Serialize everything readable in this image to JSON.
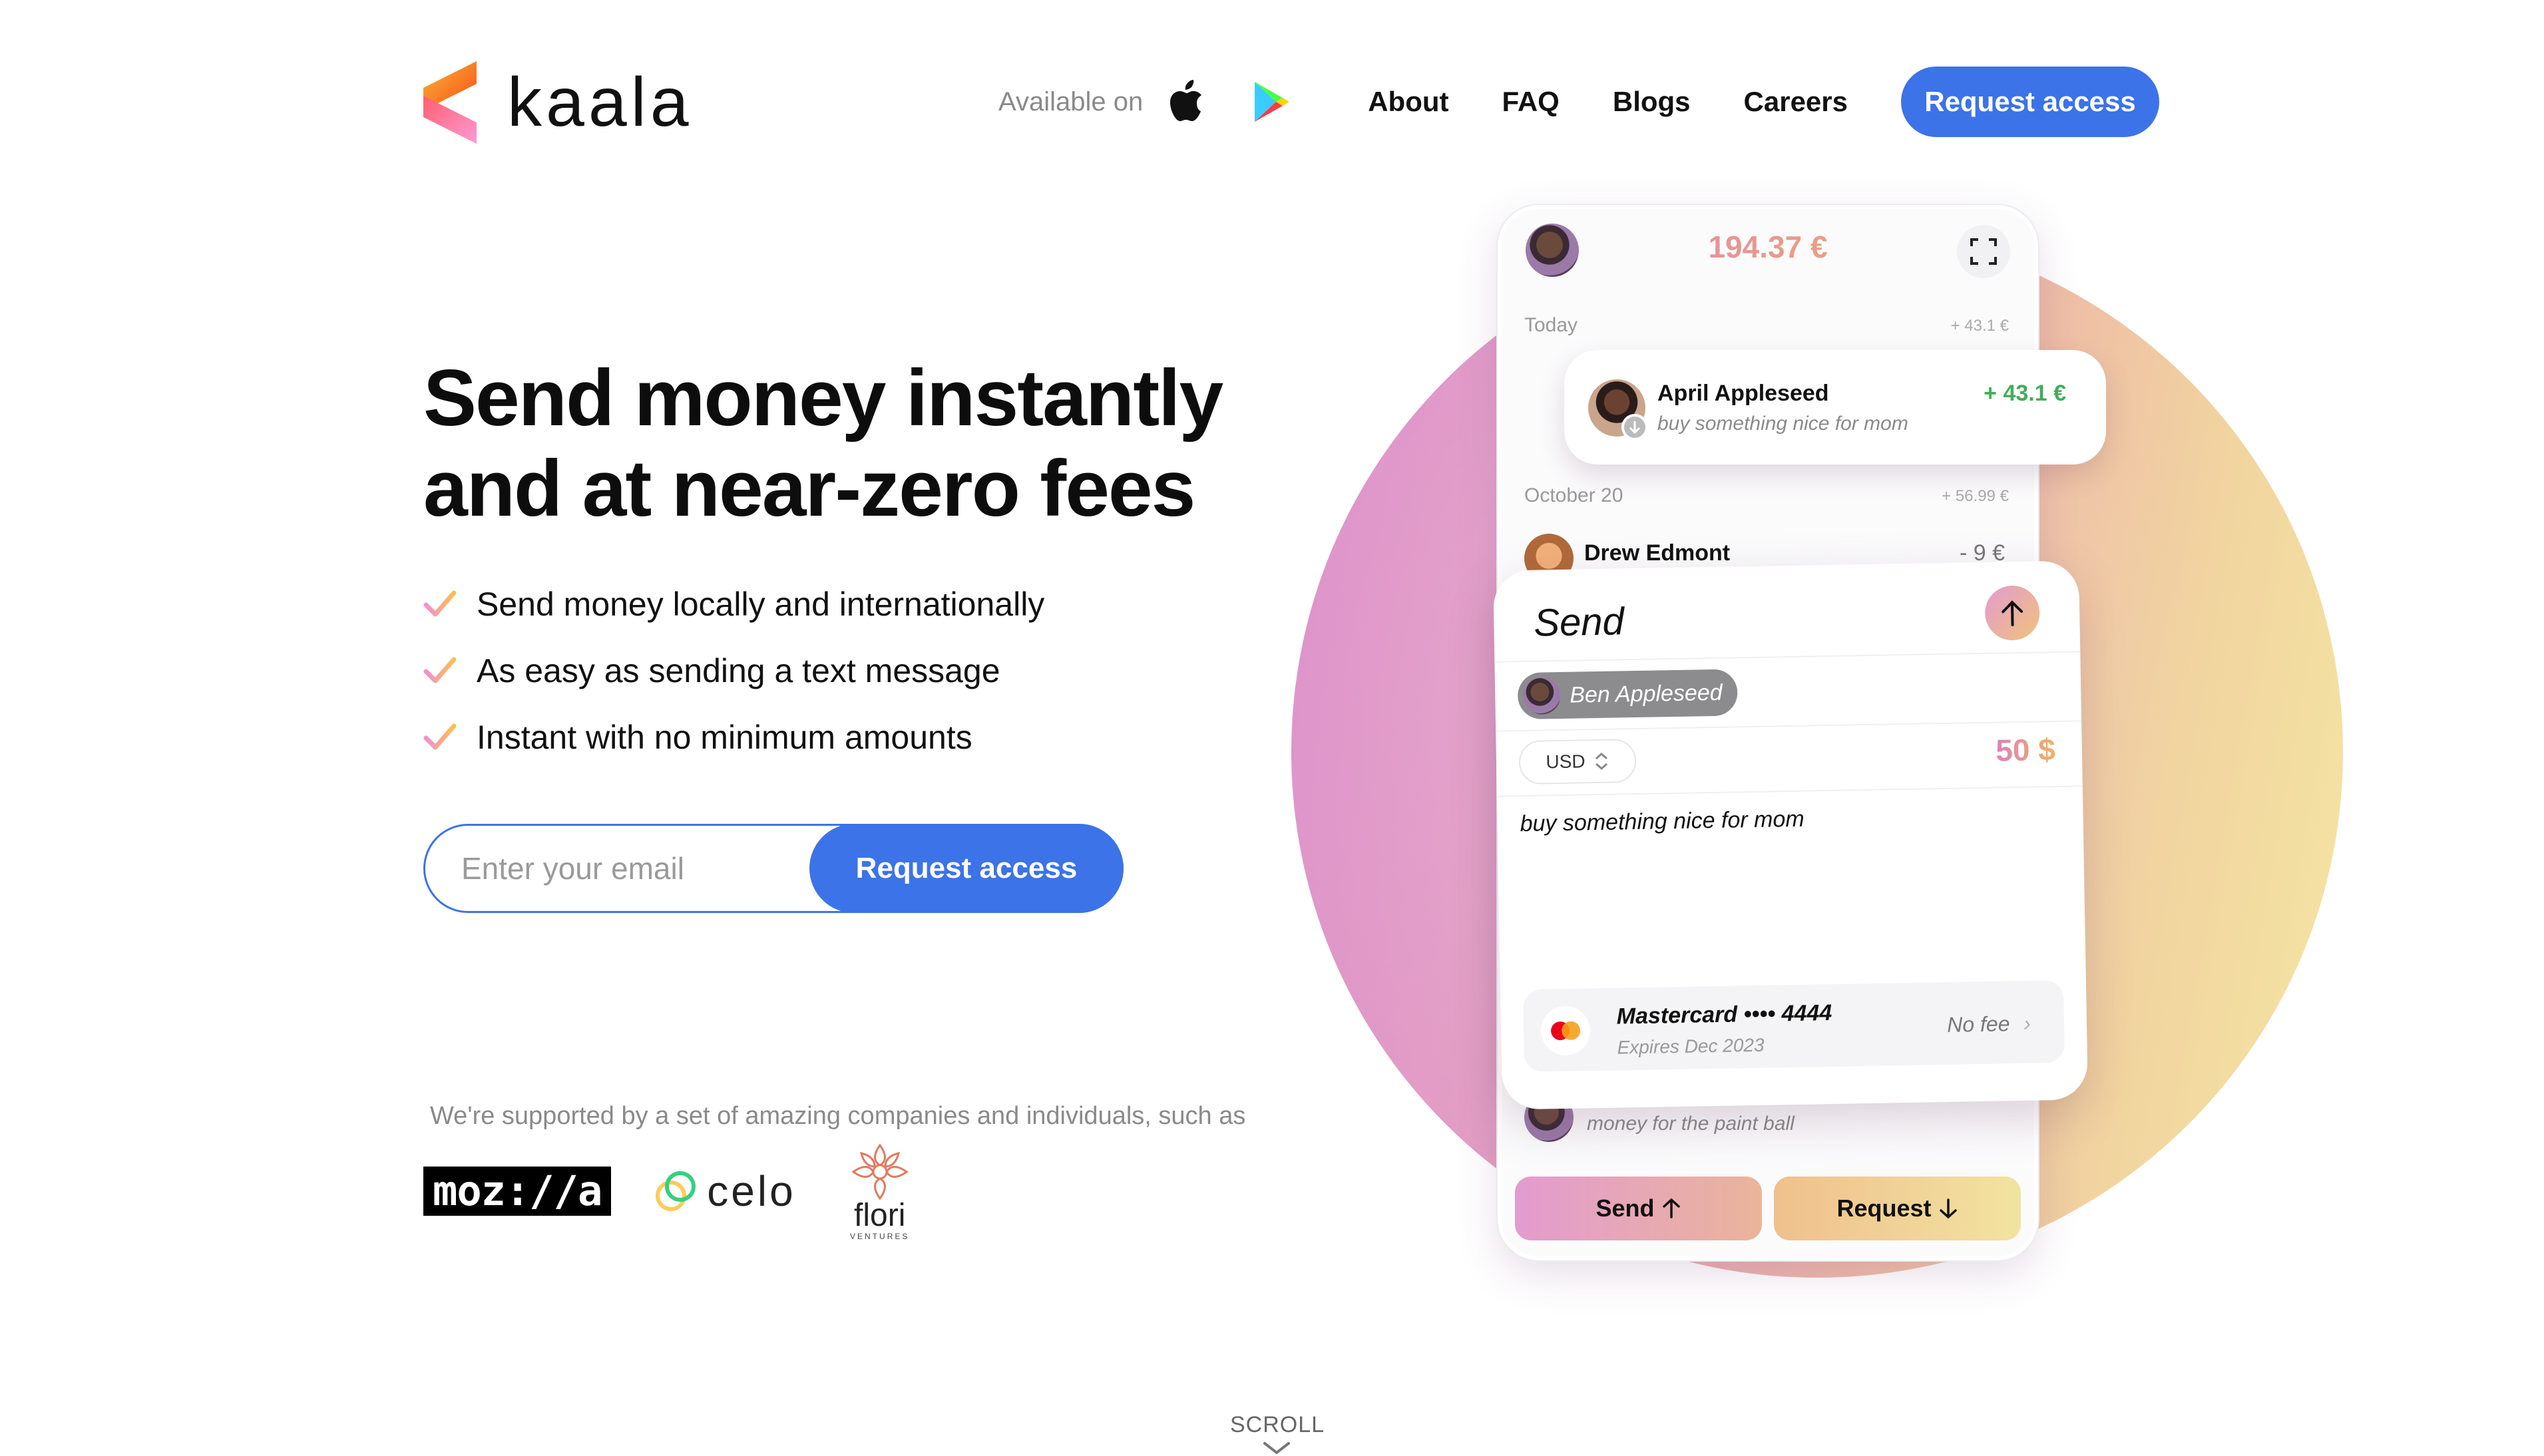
{
  "brand": {
    "name": "kaala"
  },
  "nav": {
    "available_label": "Available on",
    "links": [
      "About",
      "FAQ",
      "Blogs",
      "Careers"
    ],
    "cta": "Request access"
  },
  "hero": {
    "title_line1": "Send money instantly",
    "title_line2": "and at near-zero fees",
    "bullets": [
      "Send money locally and internationally",
      "As easy as sending a text message",
      "Instant with no minimum amounts"
    ],
    "email_placeholder": "Enter your email",
    "email_button": "Request access"
  },
  "supporters": {
    "caption": "We're supported by a set of amazing companies and individuals, such as",
    "logos": [
      "moz://a",
      "celo",
      "flori"
    ],
    "flori_sub": "VENTURES"
  },
  "scroll_label": "SCROLL",
  "phone": {
    "balance": "194.37 €",
    "groups": [
      {
        "day": "Today",
        "sum": "+ 43.1 €"
      },
      {
        "day": "October 20",
        "sum": "+ 56.99 €"
      }
    ],
    "notification": {
      "name": "April Appleseed",
      "note": "buy something nice for mom",
      "amount": "+ 43.1 €"
    },
    "rows": [
      {
        "name": "Drew Edmont",
        "amount": "- 9 €"
      }
    ],
    "visible_note": "money for the paint ball",
    "bottom_send": "Send",
    "bottom_request": "Request"
  },
  "send_card": {
    "title": "Send",
    "recipient": "Ben Appleseed",
    "currency": "USD",
    "amount": "50 $",
    "memo": "buy something nice for mom",
    "card_name": "Mastercard •••• 4444",
    "card_expiry": "Expires Dec 2023",
    "fee": "No fee"
  },
  "colors": {
    "accent": "#3c73e8",
    "gradient_pink": "#e07fbd",
    "gradient_gold": "#f0b35f",
    "positive": "#3fae5a"
  }
}
